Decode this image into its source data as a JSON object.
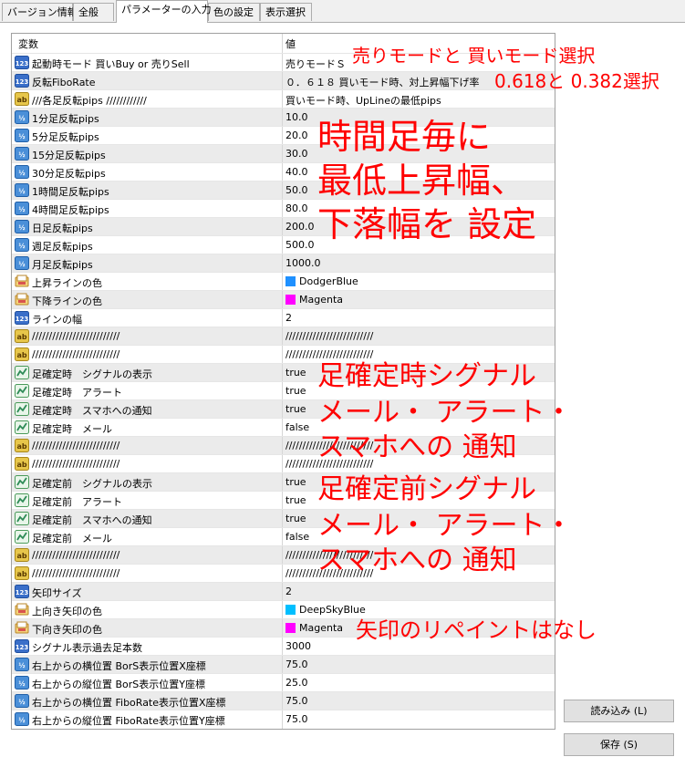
{
  "tabs": [
    "バージョン情報",
    "全般",
    "パラメーターの入力",
    "色の設定",
    "表示選択"
  ],
  "active_tab": 2,
  "table": {
    "col_name": "変数",
    "col_value": "値",
    "rows": [
      {
        "icon": "123",
        "name": "起動時モード 買いBuy or 売りSell",
        "value": "売りモードＳ"
      },
      {
        "icon": "123",
        "name": "反転FiboRate",
        "value": "０．６１８ 買いモード時、対上昇幅下げ率"
      },
      {
        "icon": "ab",
        "name": "///各足反転pips ////////////",
        "value": "買いモード時、UpLineの最低pips"
      },
      {
        "icon": "half",
        "name": "1分足反転pips",
        "value": "10.0"
      },
      {
        "icon": "half",
        "name": "5分足反転pips",
        "value": "20.0"
      },
      {
        "icon": "half",
        "name": "15分足反転pips",
        "value": "30.0"
      },
      {
        "icon": "half",
        "name": "30分足反転pips",
        "value": "40.0"
      },
      {
        "icon": "half",
        "name": "1時間足反転pips",
        "value": "50.0"
      },
      {
        "icon": "half",
        "name": "4時間足反転pips",
        "value": "80.0"
      },
      {
        "icon": "half",
        "name": "日足反転pips",
        "value": "200.0"
      },
      {
        "icon": "half",
        "name": "週足反転pips",
        "value": "500.0"
      },
      {
        "icon": "half",
        "name": "月足反転pips",
        "value": "1000.0"
      },
      {
        "icon": "color",
        "name": "上昇ラインの色",
        "value": "DodgerBlue",
        "swatch": "#1e90ff"
      },
      {
        "icon": "color",
        "name": "下降ラインの色",
        "value": "Magenta",
        "swatch": "#ff00ff"
      },
      {
        "icon": "123",
        "name": "ラインの幅",
        "value": "2"
      },
      {
        "icon": "ab",
        "name": "//////////////////////////",
        "value": "//////////////////////////"
      },
      {
        "icon": "ab",
        "name": "//////////////////////////",
        "value": "//////////////////////////"
      },
      {
        "icon": "bool",
        "name": "足確定時　シグナルの表示",
        "value": "true"
      },
      {
        "icon": "bool",
        "name": "足確定時　アラート",
        "value": "true"
      },
      {
        "icon": "bool",
        "name": "足確定時　スマホへの通知",
        "value": "true"
      },
      {
        "icon": "bool",
        "name": "足確定時　メール",
        "value": "false"
      },
      {
        "icon": "ab",
        "name": "//////////////////////////",
        "value": "//////////////////////////"
      },
      {
        "icon": "ab",
        "name": "//////////////////////////",
        "value": "//////////////////////////"
      },
      {
        "icon": "bool",
        "name": "足確定前　シグナルの表示",
        "value": "true"
      },
      {
        "icon": "bool",
        "name": "足確定前　アラート",
        "value": "true"
      },
      {
        "icon": "bool",
        "name": "足確定前　スマホへの通知",
        "value": "true"
      },
      {
        "icon": "bool",
        "name": "足確定前　メール",
        "value": "false"
      },
      {
        "icon": "ab",
        "name": "//////////////////////////",
        "value": "//////////////////////////"
      },
      {
        "icon": "ab",
        "name": "//////////////////////////",
        "value": "//////////////////////////"
      },
      {
        "icon": "123",
        "name": "矢印サイズ",
        "value": "2"
      },
      {
        "icon": "color",
        "name": "上向き矢印の色",
        "value": "DeepSkyBlue",
        "swatch": "#00bfff"
      },
      {
        "icon": "color",
        "name": "下向き矢印の色",
        "value": "Magenta",
        "swatch": "#ff00ff"
      },
      {
        "icon": "123",
        "name": "シグナル表示過去足本数",
        "value": "3000"
      },
      {
        "icon": "half",
        "name": "右上からの横位置 BorS表示位置X座標",
        "value": "75.0"
      },
      {
        "icon": "half",
        "name": "右上からの縦位置 BorS表示位置Y座標",
        "value": "25.0"
      },
      {
        "icon": "half",
        "name": "右上からの横位置 FiboRate表示位置X座標",
        "value": "75.0"
      },
      {
        "icon": "half",
        "name": "右上からの縦位置 FiboRate表示位置Y座標",
        "value": "75.0"
      }
    ]
  },
  "buttons": {
    "load": "読み込み (L)",
    "save": "保存 (S)"
  },
  "annotations": {
    "mode_select": "売りモードと 買いモード選択",
    "fibo_select": "0.618と 0.382選択",
    "timeframe_1": "時間足毎に",
    "timeframe_2": "最低上昇幅、",
    "timeframe_3": "下落幅を 設定",
    "confirmed_1": "足確定時シグナル",
    "confirmed_2": "メール・ アラート・",
    "confirmed_3": "スマホへの 通知",
    "before_1": "足確定前シグナル",
    "before_2": "メール・ アラート・",
    "before_3": "スマホへの 通知",
    "no_repaint": "矢印のリペイントはなし"
  },
  "colors": {
    "annotation": "#ff0000",
    "icon_blue": "#1f5fbf",
    "icon_ab": "#c8a000",
    "icon_bool": "#2e8b57"
  }
}
